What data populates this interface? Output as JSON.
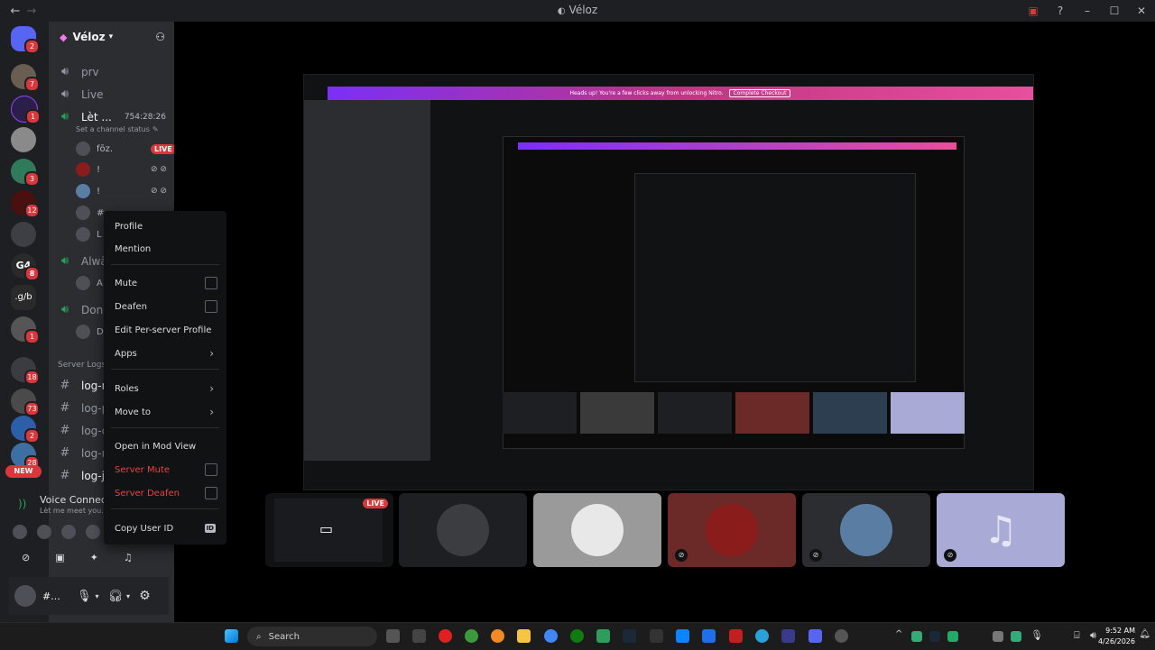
{
  "window": {
    "title": "Véloz",
    "back_icon": "arrow-left-icon",
    "forward_icon": "arrow-right-icon"
  },
  "guild": {
    "name": "Véloz"
  },
  "rail": {
    "servers": [
      {
        "name": "home",
        "badge": "2"
      },
      {
        "name": "server-1",
        "badge": "7"
      },
      {
        "name": "twitch",
        "badge": "1"
      },
      {
        "name": "server-3",
        "badge": ""
      },
      {
        "name": "server-4",
        "badge": "3"
      },
      {
        "name": "server-5",
        "badge": "12"
      },
      {
        "name": "server-6",
        "badge": ""
      },
      {
        "name": "g4",
        "badge": "8"
      },
      {
        "name": "gb",
        "badge": ""
      },
      {
        "name": "server-9",
        "badge": "1"
      },
      {
        "name": "server-10",
        "badge": "18"
      },
      {
        "name": "server-11",
        "badge": "73"
      },
      {
        "name": "server-12",
        "badge": "2"
      },
      {
        "name": "server-13",
        "badge": "28"
      }
    ],
    "g4_label": "G4",
    "gb_label": ".g/b",
    "new_label": "NEW"
  },
  "channels": {
    "prv": "prv",
    "live": "Live",
    "voice1": "Lèt ...",
    "voice1_timer": "754:28:26",
    "voice1_status": "Set a channel status",
    "member1": "fōz.",
    "member2": "!",
    "member3": "!",
    "member4": "#",
    "member5": "L",
    "voice2": "Alwā...",
    "voice2_member": "A",
    "voice3": "Don'...",
    "voice3_member": "D",
    "category": "Server Logs",
    "logs": [
      "log-m",
      "log-pi",
      "log-ch",
      "log-ni",
      "log-jo"
    ],
    "live_badge": "LIVE"
  },
  "voice": {
    "title": "Voice Connec",
    "sub": "Lèt me meet you.."
  },
  "user_panel": {
    "name": "#..."
  },
  "context_menu": {
    "profile": "Profile",
    "mention": "Mention",
    "mute": "Mute",
    "deafen": "Deafen",
    "edit_profile": "Edit Per-server Profile",
    "apps": "Apps",
    "roles": "Roles",
    "move_to": "Move to",
    "mod_view": "Open in Mod View",
    "server_mute": "Server Mute",
    "server_deafen": "Server Deafen",
    "copy_id": "Copy User ID",
    "id_badge": "ID"
  },
  "stream": {
    "nitro_banner": "Heads up! You're a few clicks away from unlocking Nitro.",
    "nitro_button": "Complete Checkout",
    "tile_live": "LIVE"
  },
  "taskbar": {
    "search": "Search",
    "time": "9:52 AM",
    "date": "4/26/2026"
  },
  "colors": {
    "accent": "#5865f2",
    "danger": "#da373c",
    "green": "#23a55a",
    "tile_lavender": "#a9aad6",
    "tile_maroon": "#6b2a28"
  }
}
